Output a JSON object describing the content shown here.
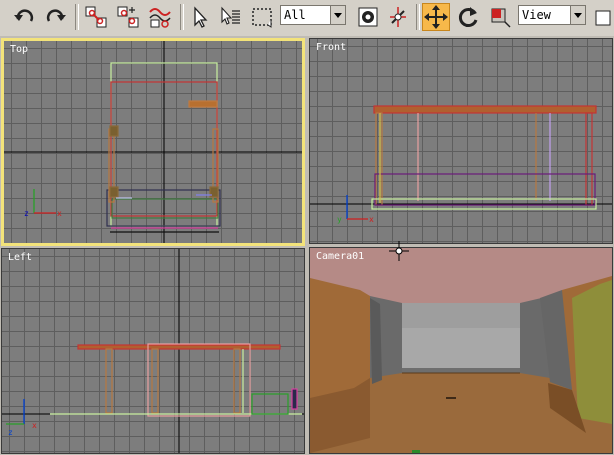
{
  "toolbar": {
    "selection_filter": "All",
    "reference_coordinate_system": "View",
    "icons": [
      "undo-icon",
      "redo-icon",
      "select-and-link-icon",
      "unlink-selection-icon",
      "bind-to-space-warp-icon",
      "select-object-icon",
      "select-by-name-icon",
      "rectangular-selection-region-icon",
      "select-filter-dropdown",
      "use-pivot-point-center-icon",
      "manipulate-icon",
      "select-and-move-icon",
      "select-and-rotate-icon",
      "select-and-scale-icon",
      "reference-coordinate-dropdown"
    ],
    "active_tool": "select-and-move"
  },
  "viewports": {
    "top_label": "Top",
    "front_label": "Front",
    "left_label": "Left",
    "camera_label": "Camera01",
    "active_viewport": "Top"
  },
  "colors": {
    "viewport_bg": "#7d7d7d",
    "grid": "#5e5e5e",
    "axis": "#000000",
    "active_border": "#f3e37a",
    "active_tool": "#f7b84a",
    "camera_sky": "#b58a86",
    "camera_floor": "#9a6a3c"
  }
}
